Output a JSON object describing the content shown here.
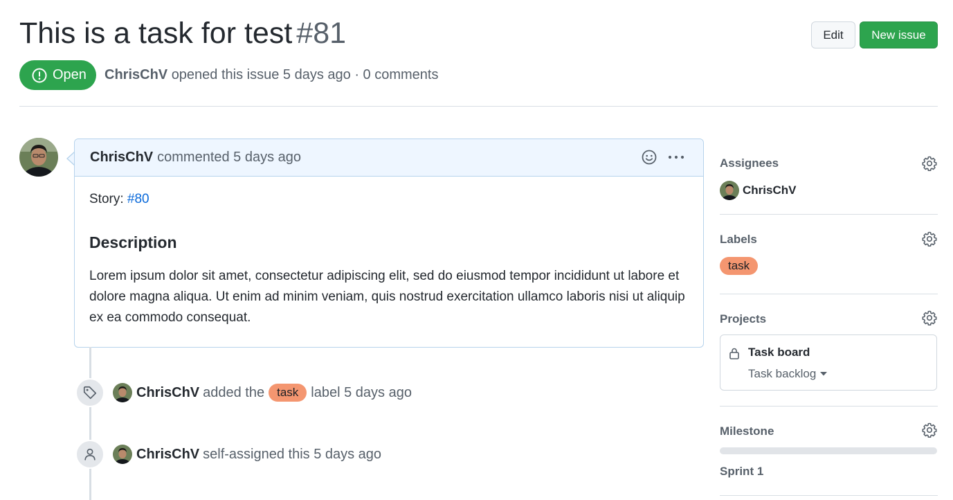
{
  "issue": {
    "title": "This is a task for test",
    "number": "#81",
    "state": "Open",
    "author": "ChrisChV",
    "opened_text": "opened this issue 5 days ago · 0 comments"
  },
  "header_buttons": {
    "edit": "Edit",
    "new_issue": "New issue"
  },
  "comment": {
    "author": "ChrisChV",
    "action": "commented 5 days ago",
    "story_prefix": "Story: ",
    "story_link": "#80",
    "heading": "Description",
    "description": "Lorem ipsum dolor sit amet, consectetur adipiscing elit, sed do eiusmod tempor incididunt ut labore et dolore magna aliqua. Ut enim ad minim veniam, quis nostrud exercitation ullamco laboris nisi ut aliquip ex ea commodo consequat."
  },
  "events": [
    {
      "icon": "tag-icon",
      "author": "ChrisChV",
      "before": "added the",
      "label": "task",
      "after": "label 5 days ago"
    },
    {
      "icon": "person-icon",
      "author": "ChrisChV",
      "text": "self-assigned this 5 days ago"
    }
  ],
  "sidebar": {
    "assignees": {
      "heading": "Assignees",
      "name": "ChrisChV"
    },
    "labels": {
      "heading": "Labels",
      "label": "task"
    },
    "projects": {
      "heading": "Projects",
      "board": "Task board",
      "column": "Task backlog"
    },
    "milestone": {
      "heading": "Milestone",
      "name": "Sprint 1",
      "progress_percent": 0
    }
  },
  "colors": {
    "open_green": "#2da44e",
    "label_task": "#f49670",
    "link_blue": "#0969da",
    "comment_header_bg": "#eef6ff"
  }
}
